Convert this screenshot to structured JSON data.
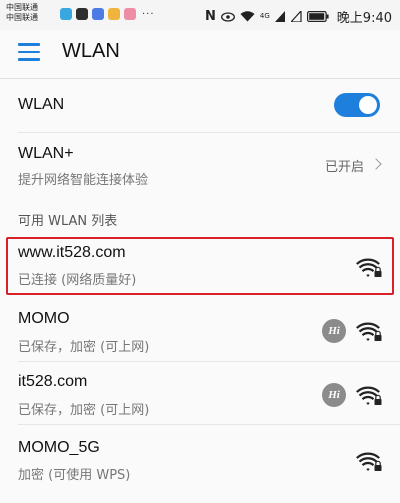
{
  "status_bar": {
    "carrier_1": "中国联通",
    "carrier_2": "中国联通",
    "dots": "···",
    "signal_label": "4G",
    "nfc": "N",
    "time": "晚上9:40",
    "app_colors": [
      "#3aa8e0",
      "#2f2f2f",
      "#4c7be6",
      "#f0b43c",
      "#ef8da7"
    ]
  },
  "app_bar": {
    "title": "WLAN",
    "menu_icon": "menu-icon"
  },
  "wlan_toggle": {
    "label": "WLAN",
    "state": "on",
    "accent_color": "#1e7fdc"
  },
  "wlan_plus": {
    "label": "WLAN+",
    "description": "提升网络智能连接体验",
    "status": "已开启"
  },
  "section": {
    "header": "可用 WLAN 列表"
  },
  "networks": [
    {
      "ssid": "www.it528.com",
      "status": "已连接 (网络质量好)",
      "hi_badge": false,
      "secured": true,
      "highlighted": true
    },
    {
      "ssid": "MOMO",
      "status": "已保存，加密 (可上网)",
      "hi_badge": true,
      "badge_text": "Hi",
      "secured": true,
      "highlighted": false
    },
    {
      "ssid": "it528.com",
      "status": "已保存，加密 (可上网)",
      "hi_badge": true,
      "badge_text": "Hi",
      "secured": true,
      "highlighted": false
    },
    {
      "ssid": "MOMO_5G",
      "status": "加密 (可使用 WPS)",
      "hi_badge": false,
      "secured": true,
      "highlighted": false
    }
  ],
  "highlight_color": "#d72027"
}
